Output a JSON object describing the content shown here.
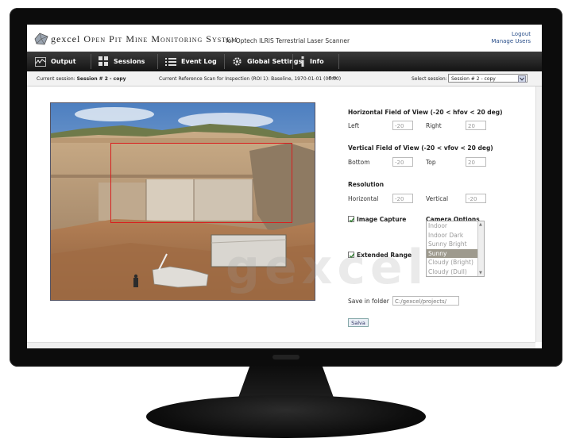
{
  "header": {
    "brand": "gexcel",
    "app_title": "Open Pit Mine Monitoring System",
    "subtitle": "for Optech ILRIS Terrestrial Laser Scanner",
    "logout": "Logout",
    "manage_users": "Manage Users"
  },
  "nav": {
    "items": [
      {
        "label": "Output",
        "icon": "waveform-icon"
      },
      {
        "label": "Sessions",
        "icon": "grid-icon"
      },
      {
        "label": "Event Log",
        "icon": "list-icon"
      },
      {
        "label": "Global Settings",
        "icon": "gear-icon"
      },
      {
        "label": "Info",
        "icon": "info-icon"
      }
    ]
  },
  "session_bar": {
    "current_label": "Current session:",
    "current_value": "Session # 2 - copy",
    "reference": "Current Reference Scan for Inspection (ROI 1): Baseline, 1970-01-01 (00:00)",
    "reference_action": "Edit",
    "select_label": "Select session:",
    "select_value": "Session # 2 - copy"
  },
  "form": {
    "hfov_title": "Horizontal Field of View (-20 < hfov < 20 deg)",
    "left_label": "Left",
    "left_value": "-20",
    "right_label": "Right",
    "right_value": "20",
    "vfov_title": "Vertical Field of View (-20 < vfov < 20 deg)",
    "bottom_label": "Bottom",
    "bottom_value": "-20",
    "top_label": "Top",
    "top_value": "20",
    "resolution_title": "Resolution",
    "horizontal_label": "Horizontal",
    "horizontal_value": "-20",
    "vertical_label": "Vertical",
    "vertical_value": "-20",
    "image_capture_label": "Image Capture",
    "image_capture_checked": true,
    "extended_range_label": "Extended Range",
    "extended_range_checked": true,
    "camera_options_title": "Camera Options",
    "camera_options": [
      "Indoor",
      "Indoor Dark",
      "Sunny Bright",
      "Sunny",
      "Cloudy (Bright)",
      "Cloudy (Dull)"
    ],
    "camera_selected": "Sunny",
    "save_folder_label": "Save in folder",
    "save_folder_value": "C:/gexcel/projects/",
    "save_button": "Salva"
  },
  "watermark": "gexcel",
  "colors": {
    "navbar": "#1e1e1e",
    "roi": "#d81e1e",
    "selected_option": "#9e9a8e",
    "link": "#2a4f8a"
  }
}
